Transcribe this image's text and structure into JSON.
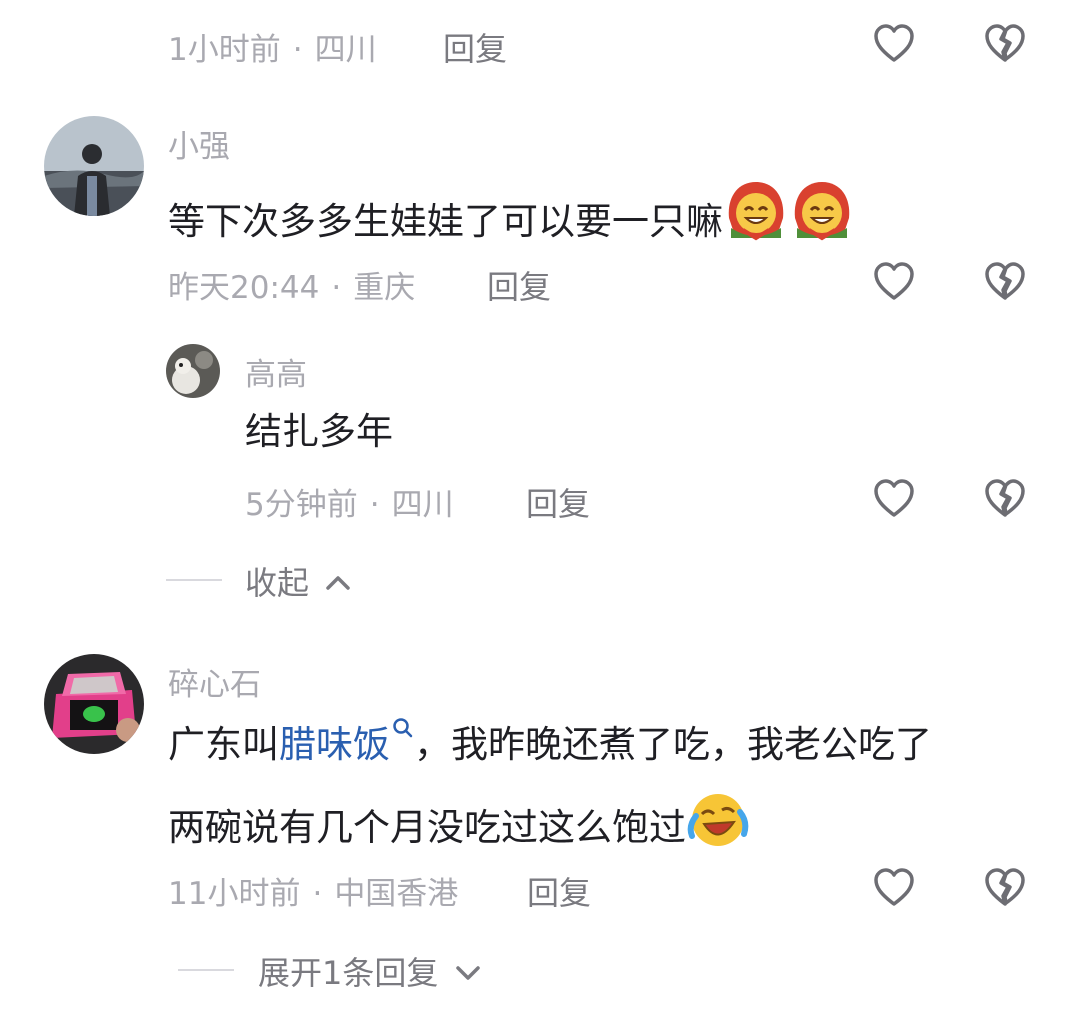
{
  "comments": [
    {
      "meta_time": "1小时前",
      "meta_location": "四川",
      "reply_label": "回复"
    },
    {
      "username": "小强",
      "text": "等下次多多生娃娃了可以要一只嘛",
      "emoji": "red-hood-grin-emoji",
      "meta_time": "昨天20:44",
      "meta_location": "重庆",
      "reply_label": "回复",
      "replies": [
        {
          "username": "高高",
          "text": "结扎多年",
          "meta_time": "5分钟前",
          "meta_location": "四川",
          "reply_label": "回复"
        }
      ],
      "collapse_label": "收起"
    },
    {
      "username": "碎心石",
      "text_line1_prefix": "广东叫",
      "text_line1_link": "腊味饭",
      "text_line1_suffix": "，我昨晚还煮了吃，我老公吃了",
      "text_line2": "两碗说有几个月没吃过这么饱过",
      "emoji": "laugh-cry-emoji",
      "meta_time": "11小时前",
      "meta_location": "中国香港",
      "reply_label": "回复",
      "expand_label": "展开1条回复"
    }
  ],
  "icons": {
    "like": "heart-outline-icon",
    "dislike": "broken-heart-icon",
    "search_hint": "search-icon",
    "chevron_up": "chevron-up-icon",
    "chevron_down": "chevron-down-icon"
  },
  "colors": {
    "text": "#1f1f24",
    "meta": "#a9a9b0",
    "link": "#2a5fb0",
    "icon": "#7a7a80"
  }
}
